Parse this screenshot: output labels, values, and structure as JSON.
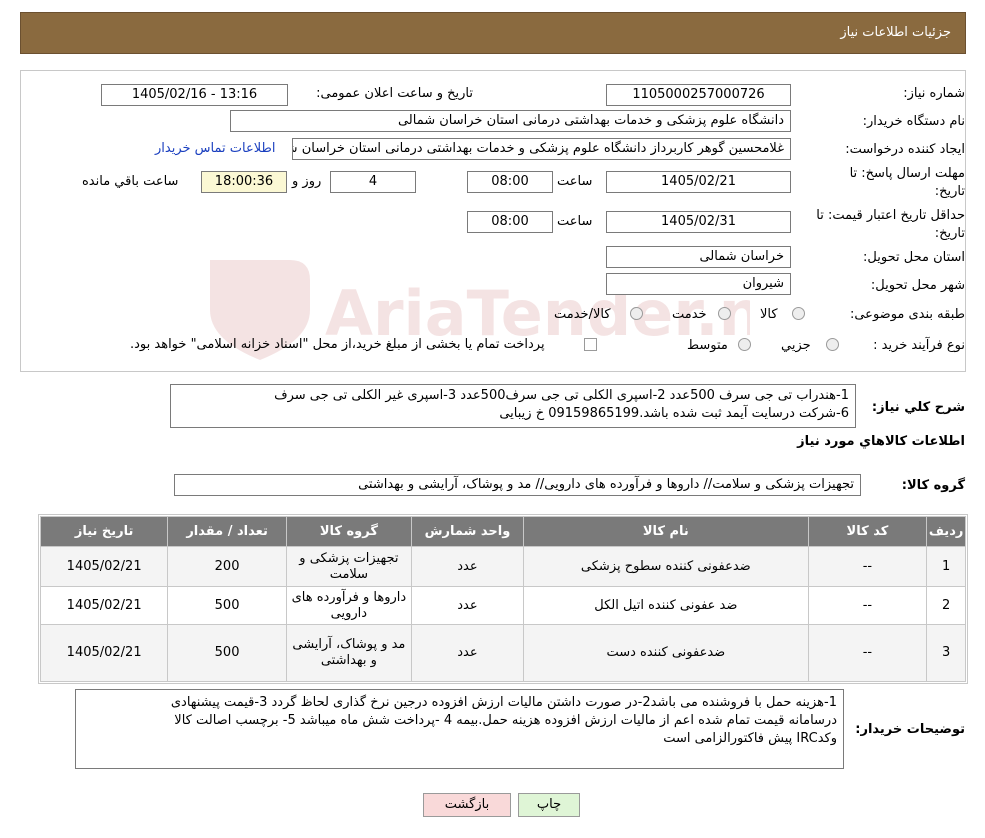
{
  "header": {
    "title": "جزئیات اطلاعات نیاز"
  },
  "form": {
    "need_number_label": "شماره نیاز:",
    "need_number": "1105000257000726",
    "announce_label": "تاریخ و ساعت اعلان عمومی:",
    "announce_value": "1405/02/16 - 13:16",
    "buyer_org_label": "نام دستگاه خریدار:",
    "buyer_org": "دانشگاه علوم پزشکی و خدمات بهداشتی درمانی استان خراسان شمالی",
    "creator_label": "ایجاد کننده درخواست:",
    "creator": "غلامحسین گوهر کاربرداز  دانشگاه علوم پزشکی و خدمات بهداشتی درمانی استان خراسان شمالی",
    "contact_link": "اطلاعات تماس خریدار",
    "reply_deadline_label_1": "مهلت ارسال پاسخ: تا",
    "reply_deadline_label_2": "تاریخ:",
    "reply_date": "1405/02/21",
    "time_label": "ساعت",
    "reply_time": "08:00",
    "days_value": "4",
    "days_label": "روز و",
    "remaining_time": "18:00:36",
    "remaining_label": "ساعت باقي مانده",
    "validity_label_1": "حداقل تاریخ اعتبار قیمت: تا",
    "validity_label_2": "تاریخ:",
    "validity_date": "1405/02/31",
    "validity_time_label": "ساعت",
    "validity_time": "08:00",
    "province_label": "استان محل تحویل:",
    "province": "خراسان شمالی",
    "city_label": "شهر محل تحویل:",
    "city": "شیروان",
    "category_label": "طبقه بندی موضوعی:",
    "category_options": [
      "کالا",
      "خدمت",
      "کالا/خدمت"
    ],
    "process_label": "نوع فرآیند خرید :",
    "process_options": [
      "جزیي",
      "متوسط"
    ],
    "process_note": "پرداخت تمام یا بخشی از مبلغ خرید،از محل \"اسناد خزانه اسلامی\" خواهد بود."
  },
  "watermark_text": "AriaTender.neT",
  "summary": {
    "label": "شرح كلي نياز:",
    "line1": "1-هندراب تی جی سرف 500عدد 2-اسپری الکلی تی جی سرف500عدد 3-اسپری غیر الکلی تی جی سرف",
    "line2": "6-شرکت درسایت آیمد ثبت شده باشد.09159865199 خ زیبایی"
  },
  "goods_info_title": "اطلاعات كالاهاي مورد نياز",
  "goods_group": {
    "label": "گروه کالا:",
    "value": "تجهیزات پزشکی و سلامت// داروها و فرآورده های دارویی// مد و پوشاک، آرایشی و بهداشتی"
  },
  "table": {
    "headers": [
      "رديف",
      "کد کالا",
      "نام کالا",
      "واحد شمارش",
      "گروه کالا",
      "تعداد / مقدار",
      "تاریخ نیاز"
    ],
    "rows": [
      {
        "idx": "1",
        "code": "--",
        "name": "ضدعفونی کننده سطوح پزشکی",
        "unit": "عدد",
        "group": "تجهیزات پزشکی و سلامت",
        "qty": "200",
        "date": "1405/02/21"
      },
      {
        "idx": "2",
        "code": "--",
        "name": "ضد عفونی کننده اتیل الکل",
        "unit": "عدد",
        "group": "داروها و فرآورده های دارویی",
        "qty": "500",
        "date": "1405/02/21"
      },
      {
        "idx": "3",
        "code": "--",
        "name": "ضدعفونی کننده دست",
        "unit": "عدد",
        "group": "مد و پوشاک، آرایشی و بهداشتی",
        "qty": "500",
        "date": "1405/02/21"
      }
    ]
  },
  "buyer_notes": {
    "label": "توضیحات خریدار:",
    "line1": "1-هزینه حمل با فروشنده می باشد2-در صورت داشتن مالیات ارزش افزوده درجین نرخ گذاری لحاظ گردد 3-قیمت پیشنهادی",
    "line2": "درسامانه  قیمت تمام شده اعم از مالیات ارزش افزوده هزینه حمل.بیمه 4 -پرداخت شش ماه میباشد 5- برچسب اصالت کالا",
    "line3": "وکدIRC پیش فاکتورالزامی است"
  },
  "buttons": {
    "print": "چاپ",
    "back": "بازگشت"
  }
}
